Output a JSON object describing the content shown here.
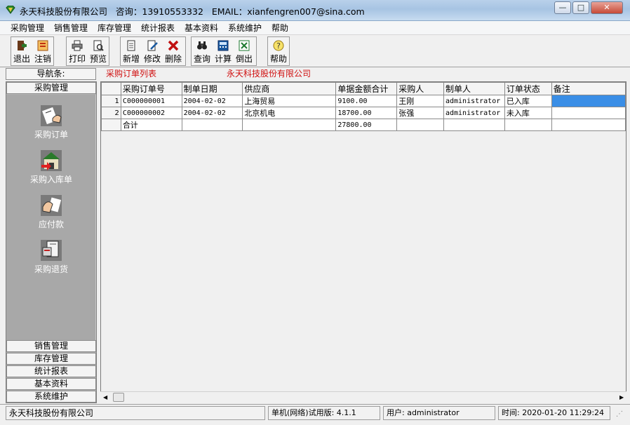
{
  "window": {
    "title": "永天科技股份有限公司   咨询：13910553332   EMAIL：xianfengren007@sina.com",
    "controls": {
      "minimize": "—",
      "maximize": "□",
      "close": "✕"
    }
  },
  "menu": [
    "采购管理",
    "销售管理",
    "库存管理",
    "统计报表",
    "基本资料",
    "系统维护",
    "帮助"
  ],
  "toolbar": {
    "buttons": [
      {
        "label": "退出",
        "icon": "exit-icon"
      },
      {
        "label": "注销",
        "icon": "logout-icon"
      },
      {
        "label": "打印",
        "icon": "print-icon"
      },
      {
        "label": "预览",
        "icon": "preview-icon"
      },
      {
        "label": "新增",
        "icon": "new-icon"
      },
      {
        "label": "修改",
        "icon": "edit-icon"
      },
      {
        "label": "删除",
        "icon": "delete-icon"
      },
      {
        "label": "查询",
        "icon": "binoculars-icon"
      },
      {
        "label": "计算",
        "icon": "calculator-icon"
      },
      {
        "label": "倒出",
        "icon": "excel-export-icon"
      },
      {
        "label": "帮助",
        "icon": "help-icon"
      }
    ]
  },
  "header": {
    "nav_label": "导航条:",
    "list_title": "采购订单列表",
    "company": "永天科技股份有限公司"
  },
  "nav": {
    "active_group": "采购管理",
    "items": [
      {
        "label": "采购订单",
        "icon": "purchase-order-icon"
      },
      {
        "label": "采购入库单",
        "icon": "warehouse-in-icon"
      },
      {
        "label": "应付款",
        "icon": "payable-icon"
      },
      {
        "label": "采购退货",
        "icon": "purchase-return-icon"
      }
    ],
    "groups": [
      "销售管理",
      "库存管理",
      "统计报表",
      "基本资料",
      "系统维护"
    ]
  },
  "grid": {
    "columns": [
      "采购订单号",
      "制单日期",
      "供应商",
      "单据金额合计",
      "采购人",
      "制单人",
      "订单状态",
      "备注"
    ],
    "rows": [
      {
        "n": "1",
        "cells": [
          "C000000001",
          "2004-02-02",
          "上海贸易",
          "9100.00",
          "王刚",
          "administrator",
          "已入库",
          ""
        ]
      },
      {
        "n": "2",
        "cells": [
          "C000000002",
          "2004-02-02",
          "北京机电",
          "18700.00",
          "张强",
          "administrator",
          "未入库",
          ""
        ]
      }
    ],
    "total": {
      "label": "合计",
      "amount": "27800.00"
    }
  },
  "status": {
    "company": "永天科技股份有限公司",
    "version": "单机(网络)试用版: 4.1.1",
    "user": "用户: administrator",
    "time": "时间: 2020-01-20 11:29:24"
  },
  "colors": {
    "accent_red": "#d01010",
    "selection": "#3a8ee6",
    "nav_bg": "#a8a8a8"
  }
}
